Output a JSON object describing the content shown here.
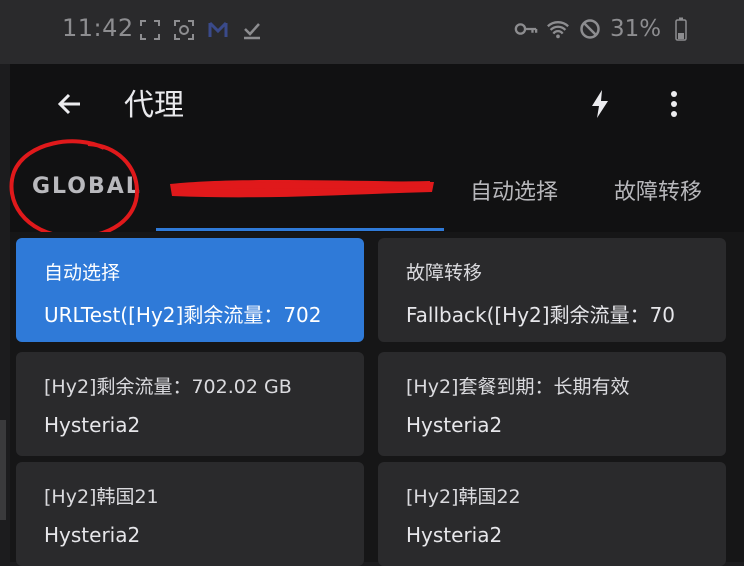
{
  "status_bar": {
    "time": "11:42",
    "battery": "31%",
    "icons_left": [
      "expand-icon",
      "scan-icon",
      "mail-icon",
      "check-download-icon"
    ],
    "icons_right": [
      "key-icon",
      "wifi-icon",
      "do-not-disturb-icon",
      "battery-icon"
    ]
  },
  "app_bar": {
    "title": "代理",
    "back_icon": "arrow-left-icon",
    "actions": [
      "flash-icon",
      "more-vert-icon"
    ]
  },
  "tabs": [
    {
      "label": "GLOBAL",
      "selected": false
    },
    {
      "label": "",
      "selected": true,
      "redacted": true
    },
    {
      "label": "自动选择",
      "selected": false
    },
    {
      "label": "故障转移",
      "selected": false
    }
  ],
  "annotations": {
    "circle_color": "#e0191b",
    "redaction_color": "#e0191b"
  },
  "colors": {
    "accent": "#2f7ad8",
    "card": "#2a2a2c",
    "background": "#111112"
  },
  "proxies": [
    {
      "name": "自动选择",
      "type": "URLTest([Hy2]剩余流量：702",
      "selected": true
    },
    {
      "name": "故障转移",
      "type": "Fallback([Hy2]剩余流量：70",
      "selected": false
    },
    {
      "name": "[Hy2]剩余流量：702.02 GB",
      "type": "Hysteria2",
      "selected": false
    },
    {
      "name": "[Hy2]套餐到期：长期有效",
      "type": "Hysteria2",
      "selected": false
    },
    {
      "name": "[Hy2]韩国21",
      "type": "Hysteria2",
      "selected": false
    },
    {
      "name": "[Hy2]韩国22",
      "type": "Hysteria2",
      "selected": false
    }
  ]
}
